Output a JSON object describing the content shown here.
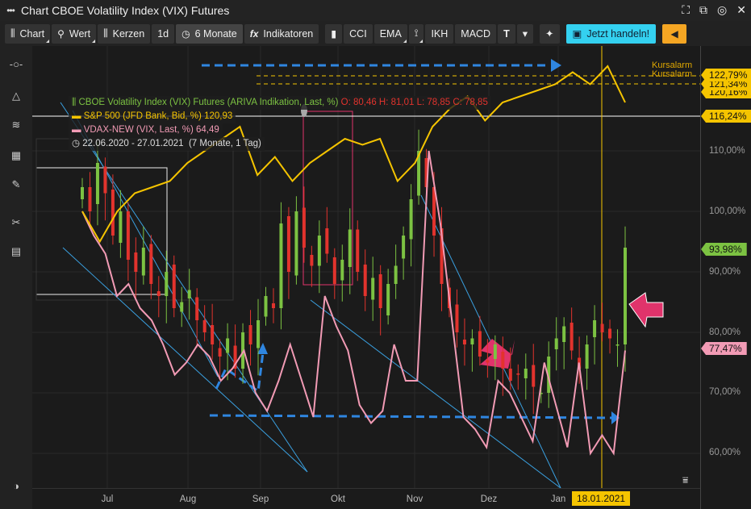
{
  "window": {
    "title": "Chart CBOE Volatility Index (VIX) Futures",
    "menu_icon": "dots-icon",
    "controls": [
      "fullscreen-icon",
      "popout-icon",
      "settings-icon",
      "close-icon"
    ]
  },
  "toolbar": {
    "chart": "Chart",
    "value": "Wert",
    "candles": "Kerzen",
    "interval": "1d",
    "period": "6 Monate",
    "indicators": "Indikatoren",
    "cci": "CCI",
    "ema": "EMA",
    "ikh": "IKH",
    "macd": "MACD",
    "trade": "Jetzt handeln!"
  },
  "legend": {
    "vix": {
      "name": "CBOE Volatility Index (VIX) Futures (ARIVA Indikation, Last, %)",
      "ohlc": "O: 80,46  H: 81,01  L: 78,85  C: 78,85"
    },
    "spx": {
      "name": "S&P 500 (JFD Bank, Bid, %)",
      "value": "120,93"
    },
    "vdax": {
      "name": "VDAX-NEW (VIX, Last, %)",
      "value": "64,49"
    },
    "range": "22.06.2020 - 27.01.2021",
    "range_detail": "(7 Monate, 1 Tag)"
  },
  "alerts": {
    "label1": "Kursalarm",
    "label2": "Kursalarm"
  },
  "tags": {
    "t1": "122,79%",
    "t2": "121,34%",
    "t3": "120,16%",
    "t4": "116,24%",
    "t5": "93,98%",
    "t6": "77,47%"
  },
  "crosshair_date": "18.01.2021",
  "colors": {
    "vix_up": "#7cc242",
    "vix_down": "#e2332d",
    "spx": "#f5c400",
    "vdax": "#f29bb5",
    "drawing": "#2f86e0"
  },
  "chart_data": {
    "type": "line",
    "xlabels": [
      "Jul",
      "Aug",
      "Sep",
      "Okt",
      "Nov",
      "Dez",
      "Jan"
    ],
    "yticks": [
      "110,00%",
      "100,00%",
      "90,00%",
      "80,00%",
      "70,00%",
      "60,00%"
    ],
    "ylim": [
      55,
      128
    ],
    "series": [
      {
        "name": "S&P 500",
        "values": [
          100,
          95,
          100,
          103,
          104,
          105,
          108,
          110,
          112,
          114,
          106,
          109,
          105,
          108,
          110,
          112,
          111,
          112,
          105,
          108,
          114,
          117,
          119,
          115,
          118,
          119,
          120,
          121,
          123,
          121,
          124,
          118
        ]
      },
      {
        "name": "VDAX-NEW",
        "values": [
          100,
          96,
          93,
          86,
          88,
          84,
          82,
          78,
          73,
          75,
          78,
          76,
          72,
          74,
          77,
          70,
          67,
          72,
          78,
          72,
          66,
          86,
          81,
          77,
          68,
          65,
          67,
          78,
          72,
          72,
          110,
          98,
          82,
          66,
          64,
          61,
          72,
          70,
          66,
          62,
          75,
          68,
          61,
          75,
          60,
          63,
          60,
          77
        ]
      },
      {
        "name": "VIX",
        "type": "candles",
        "closes": [
          104,
          100,
          108,
          103,
          96,
          100,
          92,
          90,
          94,
          88,
          86,
          90,
          84,
          85,
          87,
          82,
          80,
          78,
          76,
          79,
          74,
          80,
          78,
          82,
          86,
          84,
          98,
          90,
          100,
          94,
          91,
          96,
          93,
          88,
          92,
          97,
          90,
          86,
          89,
          84,
          88,
          91,
          96,
          102,
          110,
          104,
          96,
          88,
          84,
          80,
          78,
          79,
          76,
          75,
          78,
          74,
          72,
          73,
          74,
          71,
          70,
          76,
          79,
          81,
          77,
          74,
          78,
          82,
          80,
          79,
          78,
          94
        ]
      }
    ]
  }
}
